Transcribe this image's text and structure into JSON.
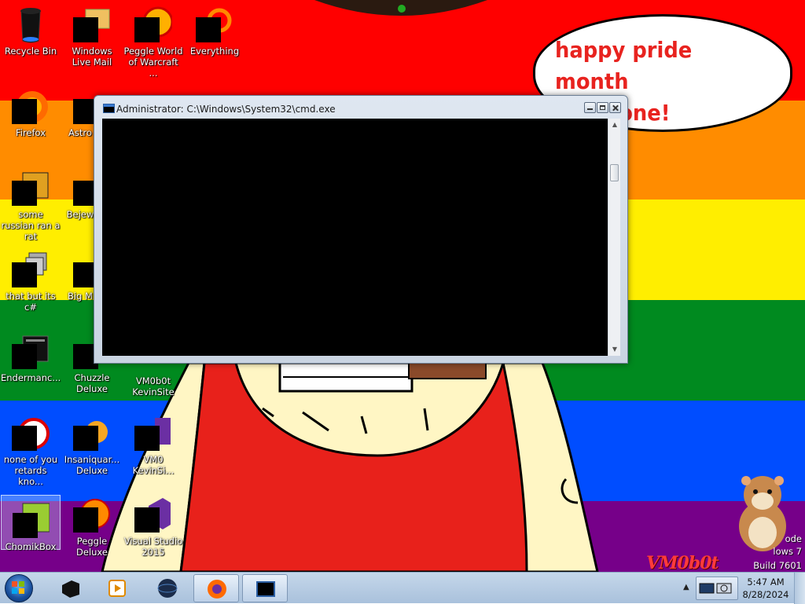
{
  "bubble": {
    "line1": "happy pride month",
    "line2": "everyone!"
  },
  "desktop_icons": [
    {
      "label": "Recycle Bin",
      "icon": "recycle-bin-icon"
    },
    {
      "label": "Windows Live Mail",
      "icon": "mail-icon"
    },
    {
      "label": "Peggle World of Warcraft ...",
      "icon": "peggle-icon"
    },
    {
      "label": "Everything",
      "icon": "search-icon"
    },
    {
      "label": "Firefox",
      "icon": "firefox-icon"
    },
    {
      "label": "Astro Delu",
      "icon": "game-icon"
    },
    {
      "label": "some russian ran a rat",
      "icon": "app-icon"
    },
    {
      "label": "Bejew Delu",
      "icon": "gem-icon"
    },
    {
      "label": "that but its c#",
      "icon": "app-icon"
    },
    {
      "label": "Big M Delu",
      "icon": "game-icon"
    },
    {
      "label": "Endermanc...",
      "icon": "app-icon"
    },
    {
      "label": "Chuzzle Deluxe",
      "icon": "chuzzle-icon"
    },
    {
      "label": "VM0b0t KevinSite",
      "icon": "app-icon"
    },
    {
      "label": "none of you retards kno...",
      "icon": "app-icon"
    },
    {
      "label": "Insaniquar... Deluxe",
      "icon": "game-icon"
    },
    {
      "label": "VM0 KevinSi...",
      "icon": "app-icon"
    },
    {
      "label": "ChomikBox",
      "icon": "chomikbox-icon"
    },
    {
      "label": "Peggle Deluxe",
      "icon": "peggle-icon"
    },
    {
      "label": "Visual Studio 2015",
      "icon": "visual-studio-icon"
    }
  ],
  "cmd_window": {
    "title": "Administrator: C:\\Windows\\System32\\cmd.exe"
  },
  "taskbar": {
    "buttons": [
      "cmd-pinned-icon",
      "media-player-icon",
      "globe-icon",
      "firefox-icon",
      "cmd-icon"
    ]
  },
  "clock": {
    "time": "5:47 AM",
    "date": "8/28/2024"
  },
  "watermark": {
    "line1": "ode",
    "line2": "lows 7",
    "line3": "Build 7601",
    "logo": "VM0b0t"
  },
  "colors": {
    "red": "#ff0000",
    "orange": "#ff8c00",
    "yellow": "#ffee00",
    "green": "#008a1f",
    "blue": "#004dff",
    "purple": "#760089",
    "bubble_text": "#e8231f"
  }
}
